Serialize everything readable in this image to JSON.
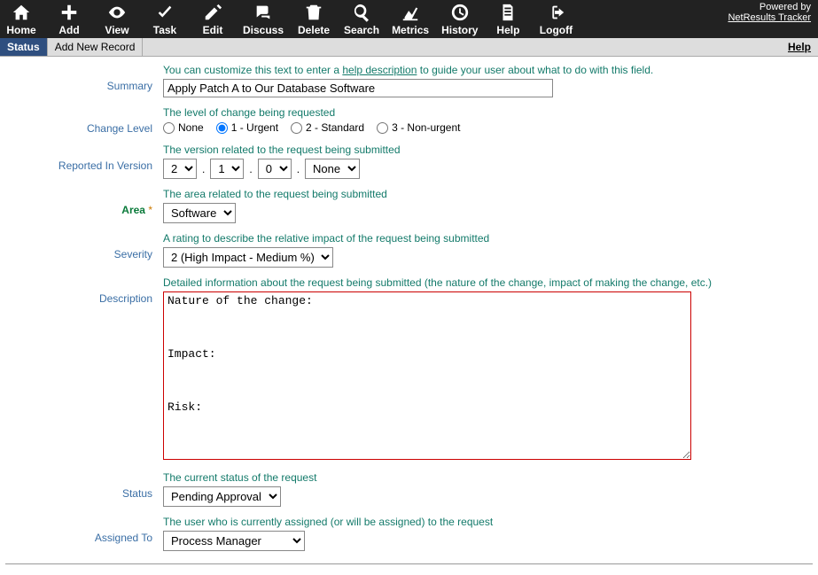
{
  "brand": {
    "powered": "Powered by",
    "name": "NetResults Tracker"
  },
  "toolbar": [
    {
      "id": "home",
      "label": "Home"
    },
    {
      "id": "add",
      "label": "Add"
    },
    {
      "id": "view",
      "label": "View"
    },
    {
      "id": "task",
      "label": "Task"
    },
    {
      "id": "edit",
      "label": "Edit"
    },
    {
      "id": "discuss",
      "label": "Discuss"
    },
    {
      "id": "delete",
      "label": "Delete"
    },
    {
      "id": "search",
      "label": "Search"
    },
    {
      "id": "metrics",
      "label": "Metrics"
    },
    {
      "id": "history",
      "label": "History"
    },
    {
      "id": "help",
      "label": "Help"
    },
    {
      "id": "logoff",
      "label": "Logoff"
    }
  ],
  "tabs": {
    "status": "Status",
    "add": "Add New Record",
    "help": "Help"
  },
  "fields": {
    "summary": {
      "label": "Summary",
      "help_pre": "You can customize this text to enter a ",
      "help_link": "help description",
      "help_post": " to guide your user about what to do with this field.",
      "value": "Apply Patch A to Our Database Software"
    },
    "change_level": {
      "label": "Change Level",
      "help": "The level of change being requested",
      "options": [
        "None",
        "1 - Urgent",
        "2 - Standard",
        "3 - Non-urgent"
      ],
      "selected": "1 - Urgent"
    },
    "reported_version": {
      "label": "Reported In Version",
      "help": "The version related to the request being submitted",
      "v1": "2",
      "v2": "1",
      "v3": "0",
      "v4": "None"
    },
    "area": {
      "label": "Area",
      "req": "*",
      "help": "The area related to the request being submitted",
      "value": "Software"
    },
    "severity": {
      "label": "Severity",
      "help": "A rating to describe the relative impact of the request being submitted",
      "value": "2 (High Impact - Medium %)"
    },
    "description": {
      "label": "Description",
      "help": "Detailed information about the request being submitted (the nature of the change, impact of making the change, etc.)",
      "value": "Nature of the change:\n\n\n\nImpact:\n\n\n\nRisk:"
    },
    "status": {
      "label": "Status",
      "help": "The current status of the request",
      "value": "Pending Approval"
    },
    "assigned": {
      "label": "Assigned To",
      "help": "The user who is currently assigned (or will be assigned) to the request",
      "value": "Process Manager"
    }
  }
}
